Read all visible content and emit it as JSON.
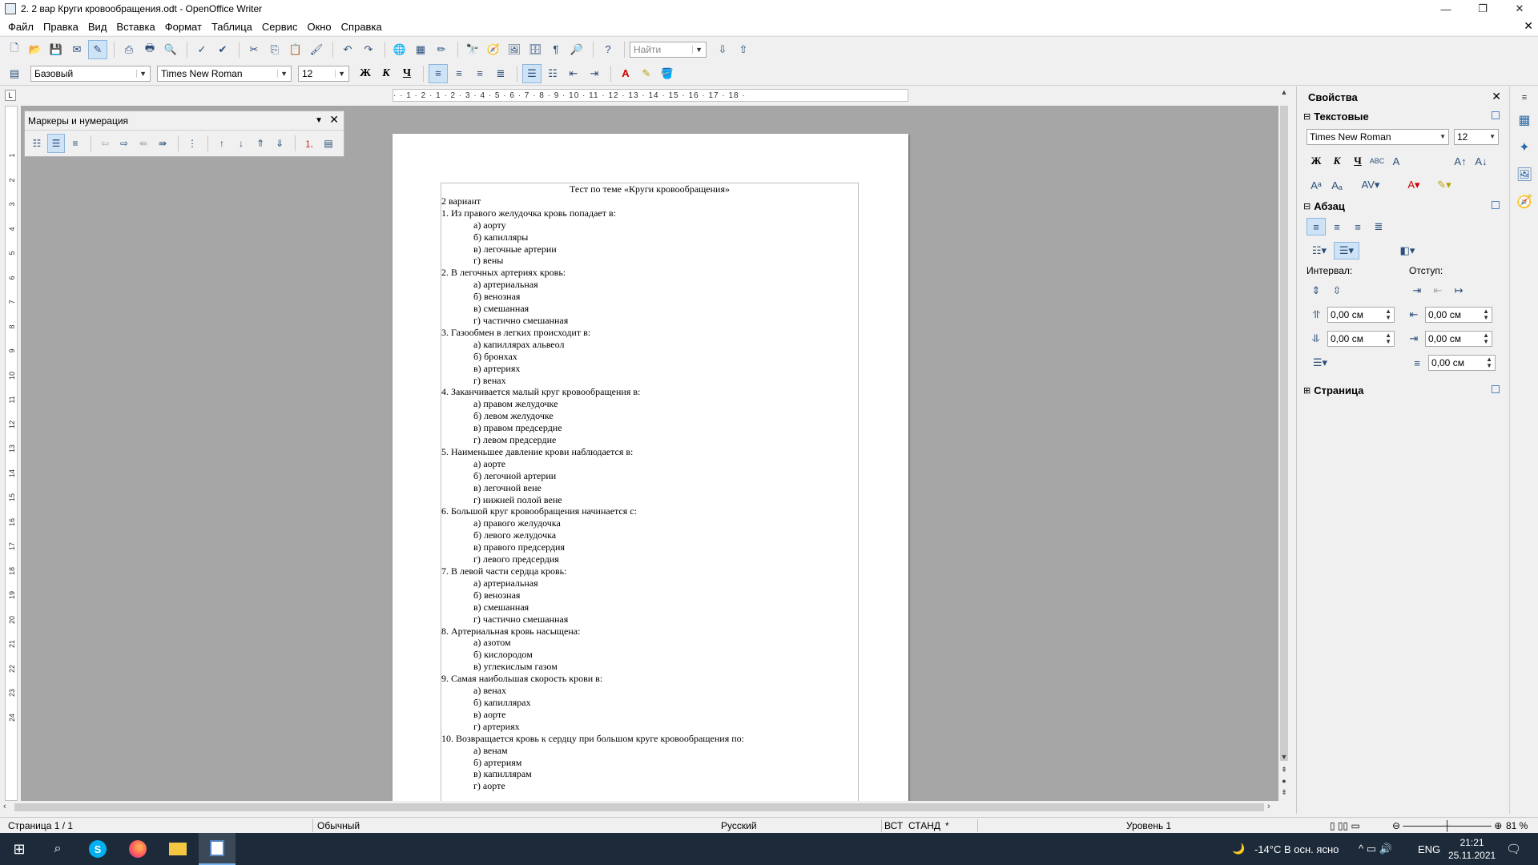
{
  "window": {
    "title": "2. 2 вар Круги кровообращения.odt - OpenOffice Writer",
    "minimize": "—",
    "maximize": "❐",
    "close": "✕"
  },
  "menu": {
    "items": [
      "Файл",
      "Правка",
      "Вид",
      "Вставка",
      "Формат",
      "Таблица",
      "Сервис",
      "Окно",
      "Справка"
    ],
    "close": "✕"
  },
  "toolbar": {
    "find_placeholder": "Найти",
    "style": "Базовый",
    "font": "Times New Roman",
    "size": "12",
    "bold": "Ж",
    "italic": "К",
    "underline": "Ч"
  },
  "ruler": {
    "text": "· · 1 · 2 · 1 · 2 · 3 · 4 · 5 · 6 · 7 · 8 · 9 · 10 · 11 · 12 · 13 · 14 · 15 · 16 · 17 · 18 ·",
    "vertical_marks": [
      "1",
      "2",
      "3",
      "4",
      "5",
      "6",
      "7",
      "8",
      "9",
      "10",
      "11",
      "12",
      "13",
      "14",
      "15",
      "16",
      "17",
      "18",
      "19",
      "20",
      "21",
      "22",
      "23",
      "24"
    ]
  },
  "bullets_toolbar": {
    "title": "Маркеры и нумерация"
  },
  "document": {
    "title": "Тест по теме «Круги кровообращения»",
    "variant": "2 вариант",
    "questions": [
      {
        "q": "1. Из правого желудочка кровь попадает в:",
        "options": [
          "а) аорту",
          "б) капилляры",
          "в) легочные артерии",
          "г) вены"
        ]
      },
      {
        "q": "2. В легочных артериях кровь:",
        "options": [
          "а) артериальная",
          "б) венозная",
          "в) смешанная",
          "г) частично смешанная"
        ]
      },
      {
        "q": "3. Газообмен в легких происходит в:",
        "options": [
          "а) капиллярах альвеол",
          "б) бронхах",
          "в) артериях",
          "г) венах"
        ]
      },
      {
        "q": "4. Заканчивается малый круг кровообращения в:",
        "options": [
          "а) правом желудочке",
          "б) левом желудочке",
          "в) правом предсердие",
          "г) левом предсердие"
        ]
      },
      {
        "q": "5. Наименьшее давление крови наблюдается в:",
        "options": [
          "а) аорте",
          "б) легочной артерии",
          "в) легочной вене",
          "г) нижней полой вене"
        ]
      },
      {
        "q": "6. Большой круг кровообращения начинается с:",
        "options": [
          "а) правого желудочка",
          "б) левого желудочка",
          "в) правого предсердия",
          "г) левого предсердия"
        ]
      },
      {
        "q": "7. В левой части сердца кровь:",
        "options": [
          "а) артериальная",
          "б) венозная",
          "в) смешанная",
          "г) частично смешанная"
        ]
      },
      {
        "q": "8. Артериальная кровь насыщена:",
        "options": [
          "а) азотом",
          "б) кислородом",
          "в) углекислым газом"
        ]
      },
      {
        "q": "9. Самая наибольшая скорость крови в:",
        "options": [
          "а) венах",
          "б) капиллярах",
          "в) аорте",
          "г) артериях"
        ]
      },
      {
        "q": "10. Возвращается кровь к сердцу при большом круге кровообращения по:",
        "options": [
          "а) венам",
          "б) артериям",
          "в) капиллярам",
          "г) аорте"
        ]
      }
    ]
  },
  "sidebar": {
    "title": "Свойства",
    "text_section": "Текстовые",
    "font": "Times New Roman",
    "size": "12",
    "paragraph_section": "Абзац",
    "spacing_label": "Интервал:",
    "indent_label": "Отступ:",
    "above": "0,00 см",
    "below": "0,00 см",
    "before": "0,00 см",
    "after": "0,00 см",
    "first": "0,00 см",
    "page_section": "Страница"
  },
  "status": {
    "page": "Страница 1 / 1",
    "style": "Обычный",
    "language": "Русский",
    "insert": "ВСТ",
    "select": "СТАНД",
    "modified": "*",
    "level": "Уровень 1",
    "zoom": "81 %"
  },
  "taskbar": {
    "weather": "-14°C В осн. ясно",
    "lang": "ENG",
    "time": "21:21",
    "date": "25.11.2021"
  }
}
